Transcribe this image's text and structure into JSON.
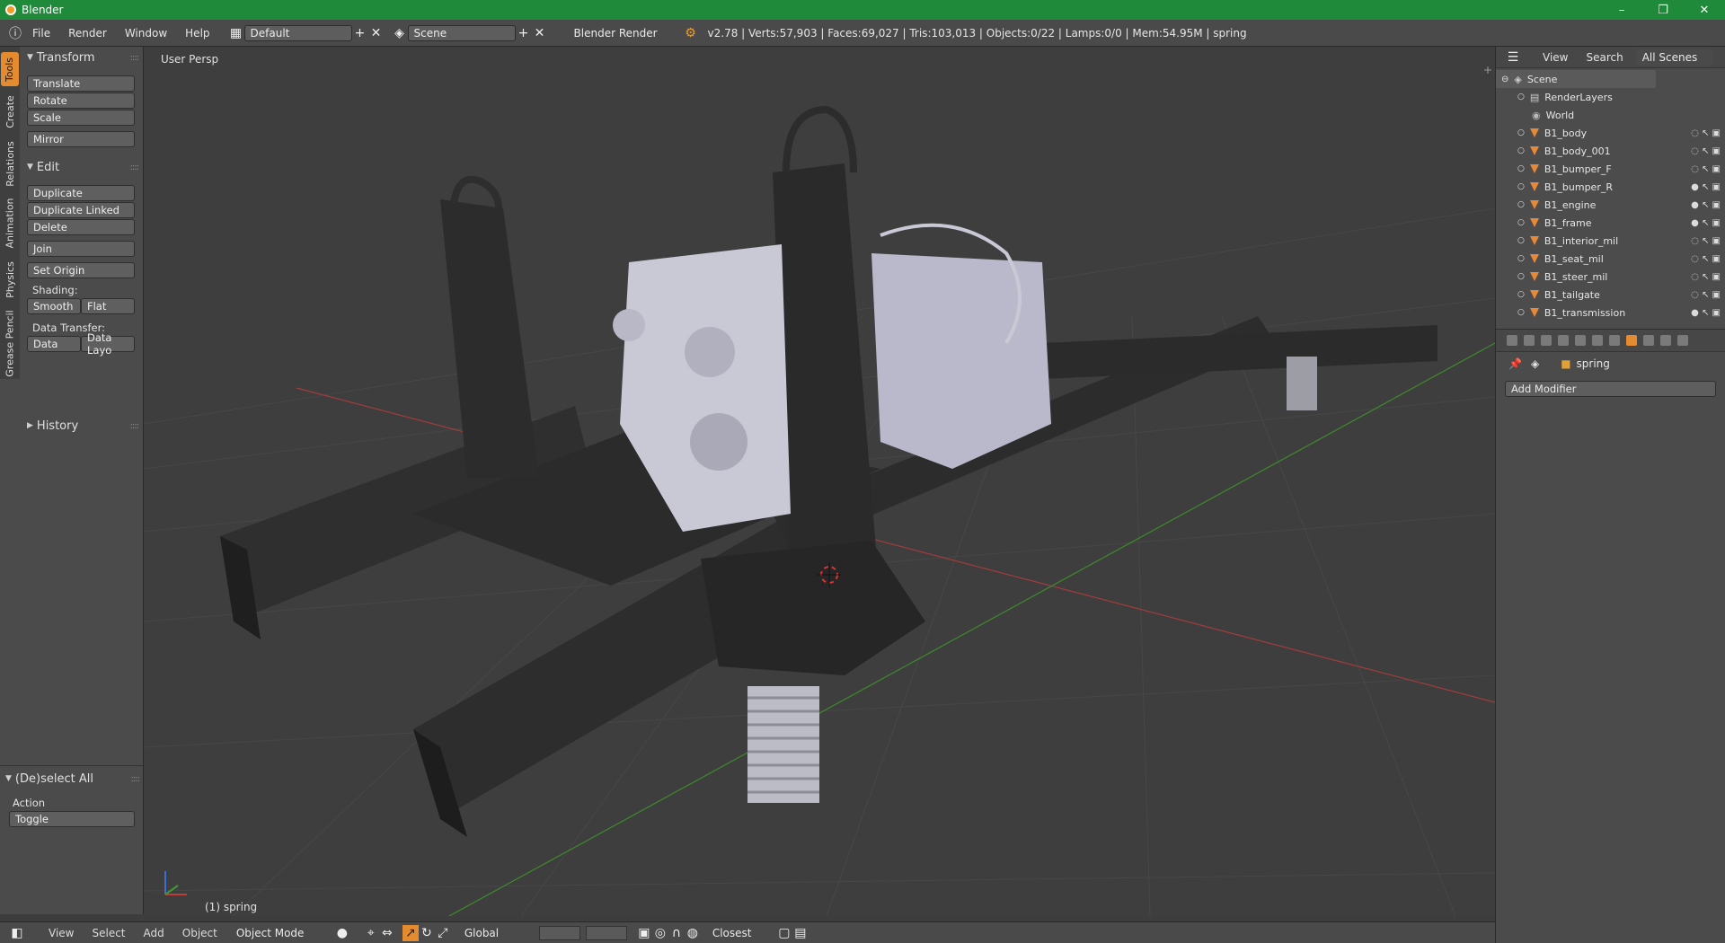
{
  "window": {
    "title": "Blender",
    "minimize": "–",
    "maximize": "❐",
    "close": "✕"
  },
  "topbar": {
    "menus": [
      "File",
      "Render",
      "Window",
      "Help"
    ],
    "screen_layout": "Default",
    "scene": "Scene",
    "engine": "Blender Render",
    "stats": "v2.78 | Verts:57,903 | Faces:69,027 | Tris:103,013 | Objects:0/22 | Lamps:0/0 | Mem:54.95M | spring"
  },
  "toolshelf": {
    "tabs": [
      "Tools",
      "Create",
      "Relations",
      "Animation",
      "Physics",
      "Grease Pencil"
    ],
    "transform": {
      "header": "Transform",
      "buttons": [
        "Translate",
        "Rotate",
        "Scale",
        "Mirror"
      ]
    },
    "edit": {
      "header": "Edit",
      "buttons": [
        "Duplicate",
        "Duplicate Linked",
        "Delete",
        "Join",
        "Set Origin"
      ],
      "shading_label": "Shading:",
      "smooth": "Smooth",
      "flat": "Flat",
      "transfer_label": "Data Transfer:",
      "data": "Data",
      "data_layout": "Data Layo"
    },
    "history": "History",
    "operator": {
      "header": "(De)select All",
      "action_label": "Action",
      "action_value": "Toggle"
    }
  },
  "viewport": {
    "label": "User Persp",
    "object": "(1) spring"
  },
  "bottombar": {
    "menus": [
      "View",
      "Select",
      "Add",
      "Object"
    ],
    "mode": "Object Mode",
    "orientation": "Global",
    "snap": "Closest"
  },
  "outliner": {
    "menus": [
      "View",
      "Search"
    ],
    "filter": "All Scenes",
    "scene": "Scene",
    "render_layers": "RenderLayers",
    "world": "World",
    "objects": [
      "B1_body",
      "B1_body_001",
      "B1_bumper_F",
      "B1_bumper_R",
      "B1_engine",
      "B1_frame",
      "B1_interior_mil",
      "B1_seat_mil",
      "B1_steer_mil",
      "B1_tailgate",
      "B1_transmission"
    ]
  },
  "properties": {
    "context_object": "spring",
    "add_modifier": "Add Modifier"
  },
  "colors": {
    "titlebar": "#1f8a3a",
    "accent": "#e38b2e",
    "viewport_bg": "#3e3e3e",
    "x_axis": "#b03a3a",
    "y_axis": "#3e8a2c"
  }
}
